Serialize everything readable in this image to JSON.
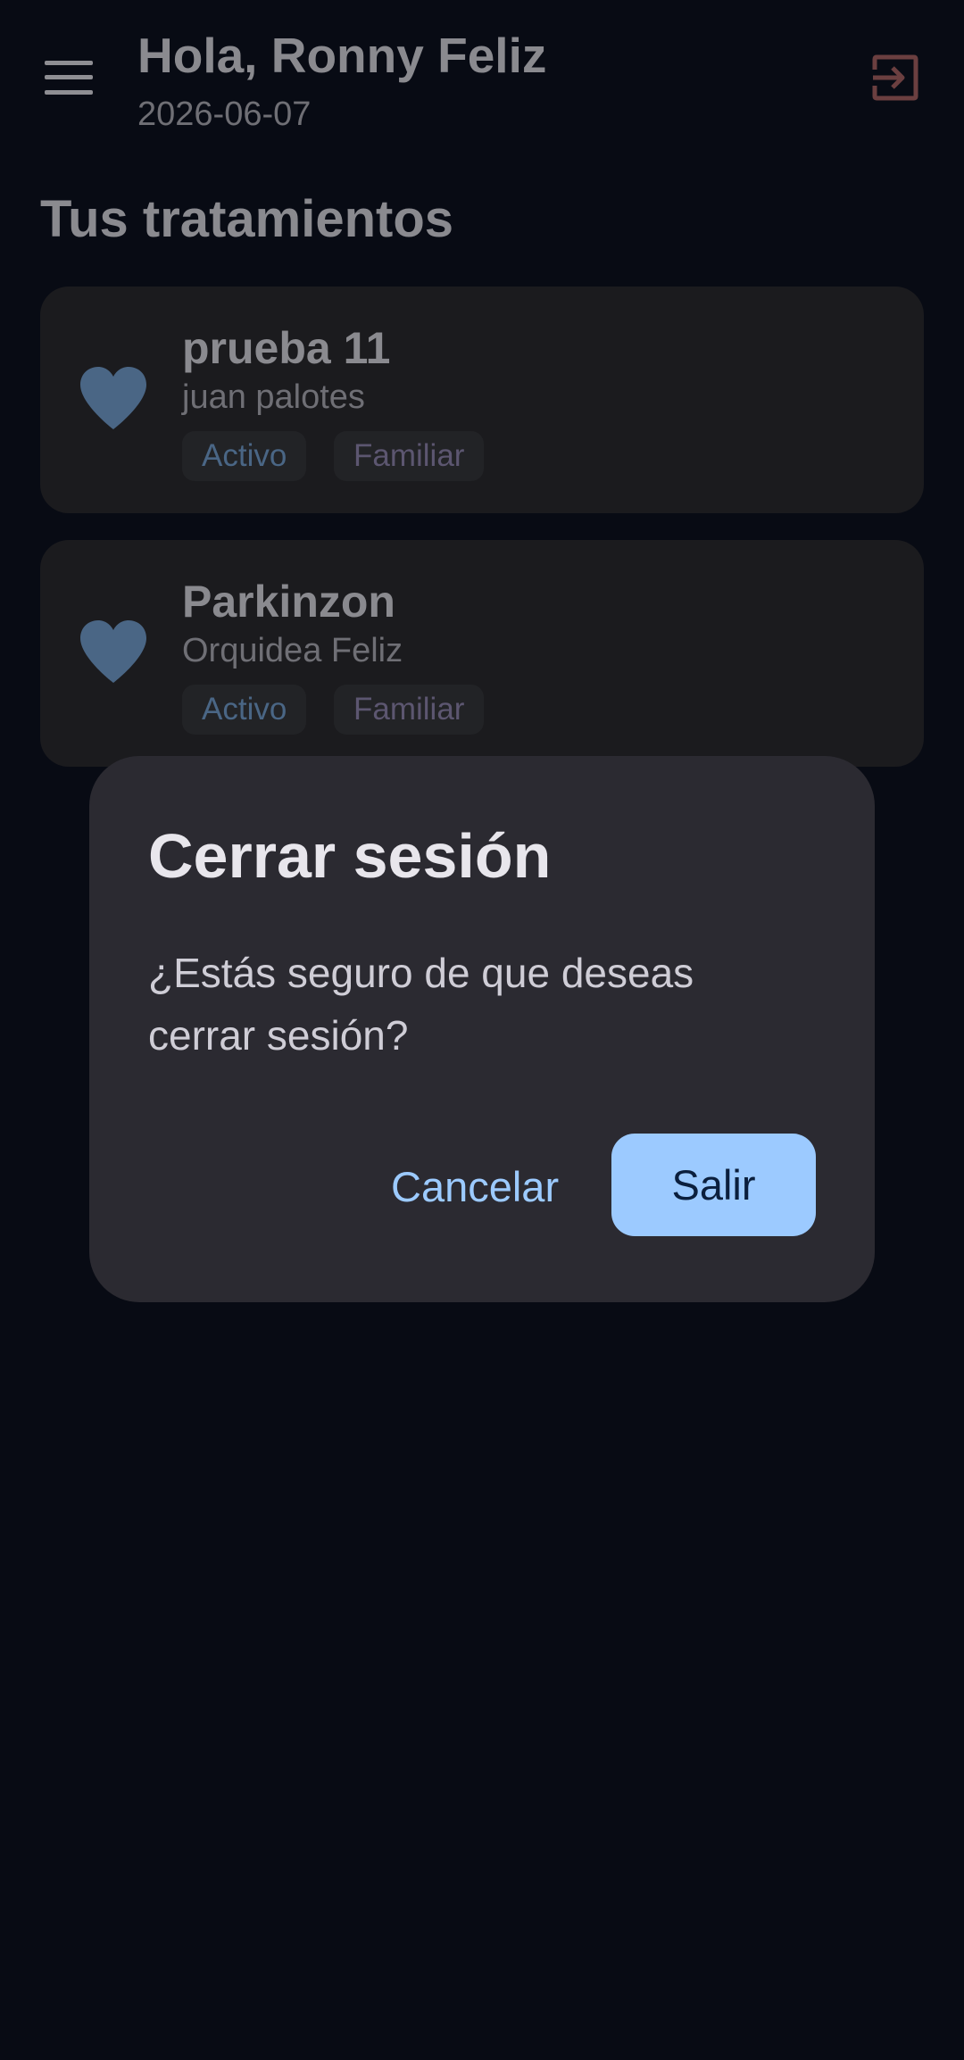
{
  "header": {
    "greeting": "Hola, Ronny Feliz",
    "date": "2026-06-07",
    "menu_icon": "menu-icon",
    "logout_icon": "logout-icon"
  },
  "section": {
    "title": "Tus tratamientos"
  },
  "treatments": [
    {
      "title": "prueba 11",
      "subtitle": "juan palotes",
      "icon": "heart-icon",
      "tags": [
        "Activo",
        "Familiar"
      ]
    },
    {
      "title": "Parkinzon",
      "subtitle": "Orquidea Feliz",
      "icon": "heart-icon",
      "tags": [
        "Activo",
        "Familiar"
      ]
    }
  ],
  "dialog": {
    "title": "Cerrar sesión",
    "message": "¿Estás seguro de que deseas cerrar sesión?",
    "cancel_label": "Cancelar",
    "confirm_label": "Salir"
  },
  "colors": {
    "background": "#080b14",
    "card": "#1b1b1e",
    "dialog": "#2b2a31",
    "accent": "#9ccaff",
    "heart": "#4a6685",
    "logout_icon": "#6b3f40"
  }
}
